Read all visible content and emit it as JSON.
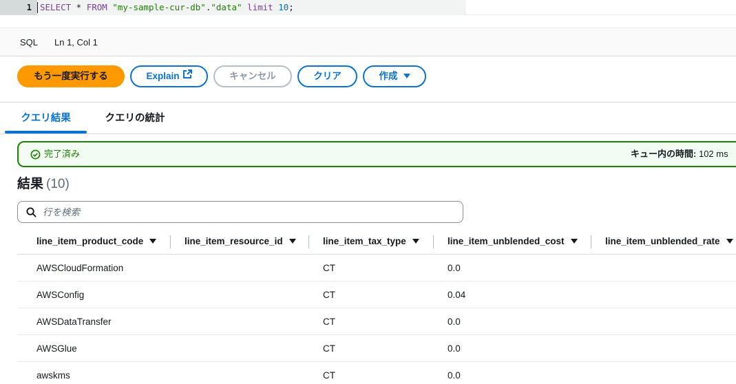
{
  "editor": {
    "line_number": "1",
    "code_tokens": [
      {
        "t": "SELECT",
        "c": "kw"
      },
      {
        "t": " * ",
        "c": "op"
      },
      {
        "t": "FROM",
        "c": "kw"
      },
      {
        "t": " ",
        "c": "op"
      },
      {
        "t": "\"my-sample-cur-db\"",
        "c": "str"
      },
      {
        "t": ".",
        "c": "op"
      },
      {
        "t": "\"data\"",
        "c": "str"
      },
      {
        "t": " ",
        "c": "op"
      },
      {
        "t": "limit",
        "c": "kw"
      },
      {
        "t": " ",
        "c": "op"
      },
      {
        "t": "10",
        "c": "num"
      },
      {
        "t": ";",
        "c": "op"
      }
    ]
  },
  "statusbar": {
    "language": "SQL",
    "position": "Ln 1, Col 1"
  },
  "toolbar": {
    "rerun_label": "もう一度実行する",
    "explain_label": "Explain",
    "cancel_label": "キャンセル",
    "clear_label": "クリア",
    "create_label": "作成"
  },
  "tabs": {
    "results_label": "クエリ結果",
    "stats_label": "クエリの統計"
  },
  "alert": {
    "status_text": "完了済み",
    "queue_label": "キュー内の時間:",
    "queue_value": "102 ms"
  },
  "results": {
    "title": "結果",
    "count": "(10)"
  },
  "search": {
    "placeholder": "行を検索",
    "value": ""
  },
  "table": {
    "columns": [
      "line_item_product_code",
      "line_item_resource_id",
      "line_item_tax_type",
      "line_item_unblended_cost",
      "line_item_unblended_rate"
    ],
    "rows": [
      [
        "AWSCloudFormation",
        "",
        "CT",
        "0.0",
        ""
      ],
      [
        "AWSConfig",
        "",
        "CT",
        "0.04",
        ""
      ],
      [
        "AWSDataTransfer",
        "",
        "CT",
        "0.0",
        ""
      ],
      [
        "AWSGlue",
        "",
        "CT",
        "0.0",
        ""
      ],
      [
        "awskms",
        "",
        "CT",
        "0.0",
        ""
      ]
    ]
  },
  "colors": {
    "primary": "#ff9900",
    "link": "#0972d3",
    "success": "#1d8102"
  }
}
